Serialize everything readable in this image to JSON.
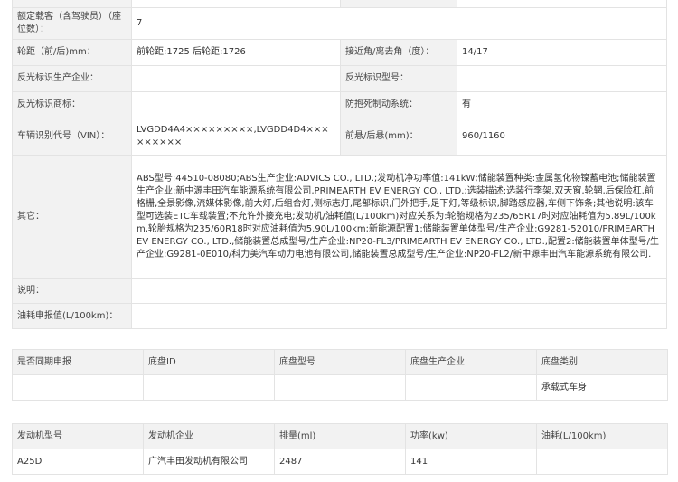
{
  "spec": {
    "rated_passengers_label": "额定载客（含驾驶员）（座位数）：",
    "rated_passengers_value": "7",
    "wheelbase_label": "轮距（前/后)mm：",
    "wheelbase_value": "前轮距:1725 后轮距:1726",
    "approach_angle_label": "接近角/离去角（度）：",
    "approach_angle_value": "14/17",
    "reflector_maker_label": "反光标识生产企业：",
    "reflector_maker_value": "",
    "reflector_model_label": "反光标识型号：",
    "reflector_model_value": "",
    "reflector_brand_label": "反光标识商标：",
    "reflector_brand_value": "",
    "abs_label": "防抱死制动系统：",
    "abs_value": "有",
    "vin_label": "车辆识别代号（VIN）：",
    "vin_value": "LVGDD4A4×××××××××,LVGDD4D4×××××××××",
    "overhang_label": "前悬/后悬(mm)：",
    "overhang_value": "960/1160",
    "other_label": "其它：",
    "other_value": "ABS型号:44510-08080;ABS生产企业:ADVICS CO., LTD.;发动机净功率值:141kW;储能装置种类:金属氢化物镍蓄电池;储能装置生产企业:新中源丰田汽车能源系统有限公司,PRIMEARTH EV ENERGY CO., LTD.;选装描述:选装行李架,双天窗,轮辋,后保险杠,前格栅,全景影像,流媒体影像,前大灯,后组合灯,侧标志灯,尾部标识,门外把手,足下灯,等级标识,脚踏感应器,车侧下饰条;其他说明:该车型可选装ETC车载装置;不允许外接充电;发动机/油耗值(L/100km)对应关系为:轮胎规格为235/65R17时对应油耗值为5.89L/100km,轮胎规格为235/60R18时对应油耗值为5.90L/100km;新能源配置1:储能装置单体型号/生产企业:G9281-52010/PRIMEARTH EV ENERGY CO., LTD.,储能装置总成型号/生产企业:NP20-FL3/PRIMEARTH EV ENERGY CO., LTD.,配置2:储能装置单体型号/生产企业:G9281-0E010/科力美汽车动力电池有限公司,储能装置总成型号/生产企业:NP20-FL2/新中源丰田汽车能源系统有限公司.",
    "note_label": "说明：",
    "note_value": "",
    "fuel_label": "油耗申报值(L/100km)：",
    "fuel_value": ""
  },
  "chassis": {
    "headers": [
      "是否同期申报",
      "底盘ID",
      "底盘型号",
      "底盘生产企业",
      "底盘类别"
    ],
    "row": [
      "",
      "",
      "",
      "",
      "承载式车身"
    ]
  },
  "engine": {
    "headers": [
      "发动机型号",
      "发动机企业",
      "排量(ml)",
      "功率(kw)",
      "油耗(L/100km)"
    ],
    "row": [
      "A25D",
      "广汽丰田发动机有限公司",
      "2487",
      "141",
      ""
    ]
  }
}
